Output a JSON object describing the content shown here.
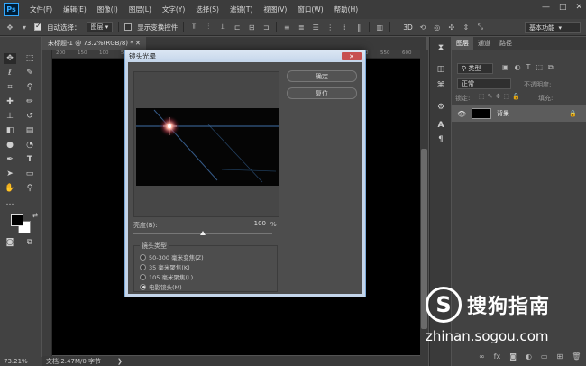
{
  "app": {
    "logo": "Ps"
  },
  "menus": [
    "文件(F)",
    "编辑(E)",
    "图像(I)",
    "图层(L)",
    "文字(Y)",
    "选择(S)",
    "滤镜(T)",
    "视图(V)",
    "窗口(W)",
    "帮助(H)"
  ],
  "window_controls": {
    "minimize": "—",
    "maximize": "□",
    "close": "✕"
  },
  "options": {
    "auto_select_label": "自动选择：",
    "auto_select_value": "图层",
    "show_transform_label": "显示变换控件",
    "workspace": "基本功能"
  },
  "document": {
    "tab_title": "未标题-1 @ 73.2%(RGB/8) *",
    "ruler_ticks": [
      "200",
      "150",
      "100",
      "50",
      "0",
      "50",
      "100",
      "150",
      "200",
      "250",
      "300",
      "350",
      "400",
      "450",
      "500",
      "550",
      "600"
    ]
  },
  "status": {
    "zoom": "73.21%",
    "doc_info": "文档:2.47M/0 字节"
  },
  "dialog": {
    "title": "镜头光晕",
    "close": "✕",
    "ok": "确定",
    "reset": "复位",
    "brightness_label": "亮度(B):",
    "brightness_value": "100",
    "brightness_unit": "%",
    "brightness_fraction": 0.5,
    "lens_title": "镜头类型",
    "lens_options": [
      "50-300 毫米变焦(Z)",
      "35 毫米聚焦(K)",
      "105 毫米聚焦(L)",
      "电影镜头(M)"
    ],
    "lens_selected_index": 3
  },
  "layers_panel": {
    "tabs": [
      "图层",
      "通道",
      "路径"
    ],
    "filter_label": "类型",
    "blend_mode": "正常",
    "opacity_label": "不透明度:",
    "lock_label": "锁定:",
    "fill_label": "填充:",
    "layer_name": "背景"
  },
  "watermark": {
    "name": "搜狗指南",
    "url": "zhinan.sogou.com",
    "logo": "S"
  }
}
